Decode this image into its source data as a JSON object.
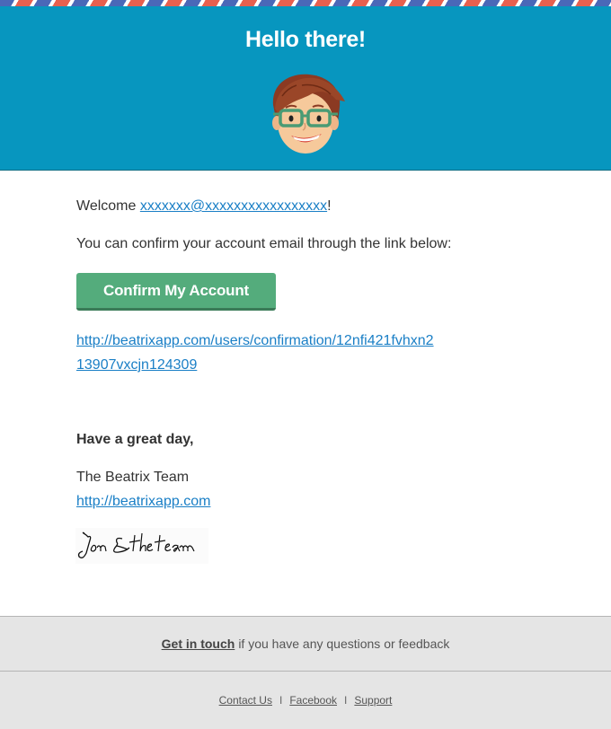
{
  "header": {
    "title": "Hello there!",
    "avatar_icon": "cartoon-avatar-with-glasses",
    "background_color": "#0796bf"
  },
  "body": {
    "welcome_prefix": "Welcome ",
    "email": "xxxxxxx@xxxxxxxxxxxxxxxxx",
    "welcome_suffix": "!",
    "intro": "You can confirm your account email through the link below:",
    "confirm_button": "Confirm My Account",
    "confirmation_link": "http://beatrixapp.com/users/confirmation/12nfi421fvhxn213907vxcjn124309",
    "closing": "Have a great day,",
    "team_name": "The Beatrix Team",
    "site_link": "http://beatrixapp.com",
    "signature_text": "Jon & the team"
  },
  "footer": {
    "get_in_touch": "Get in touch",
    "get_in_touch_suffix": "if you have any questions or feedback",
    "links": [
      "Contact Us",
      "Facebook",
      "Support"
    ],
    "separator": "I"
  },
  "colors": {
    "accent": "#0796bf",
    "button": "#54ac7c",
    "link": "#1a7fc6",
    "stripe_red": "#e8604f",
    "stripe_blue": "#4a68b8"
  }
}
